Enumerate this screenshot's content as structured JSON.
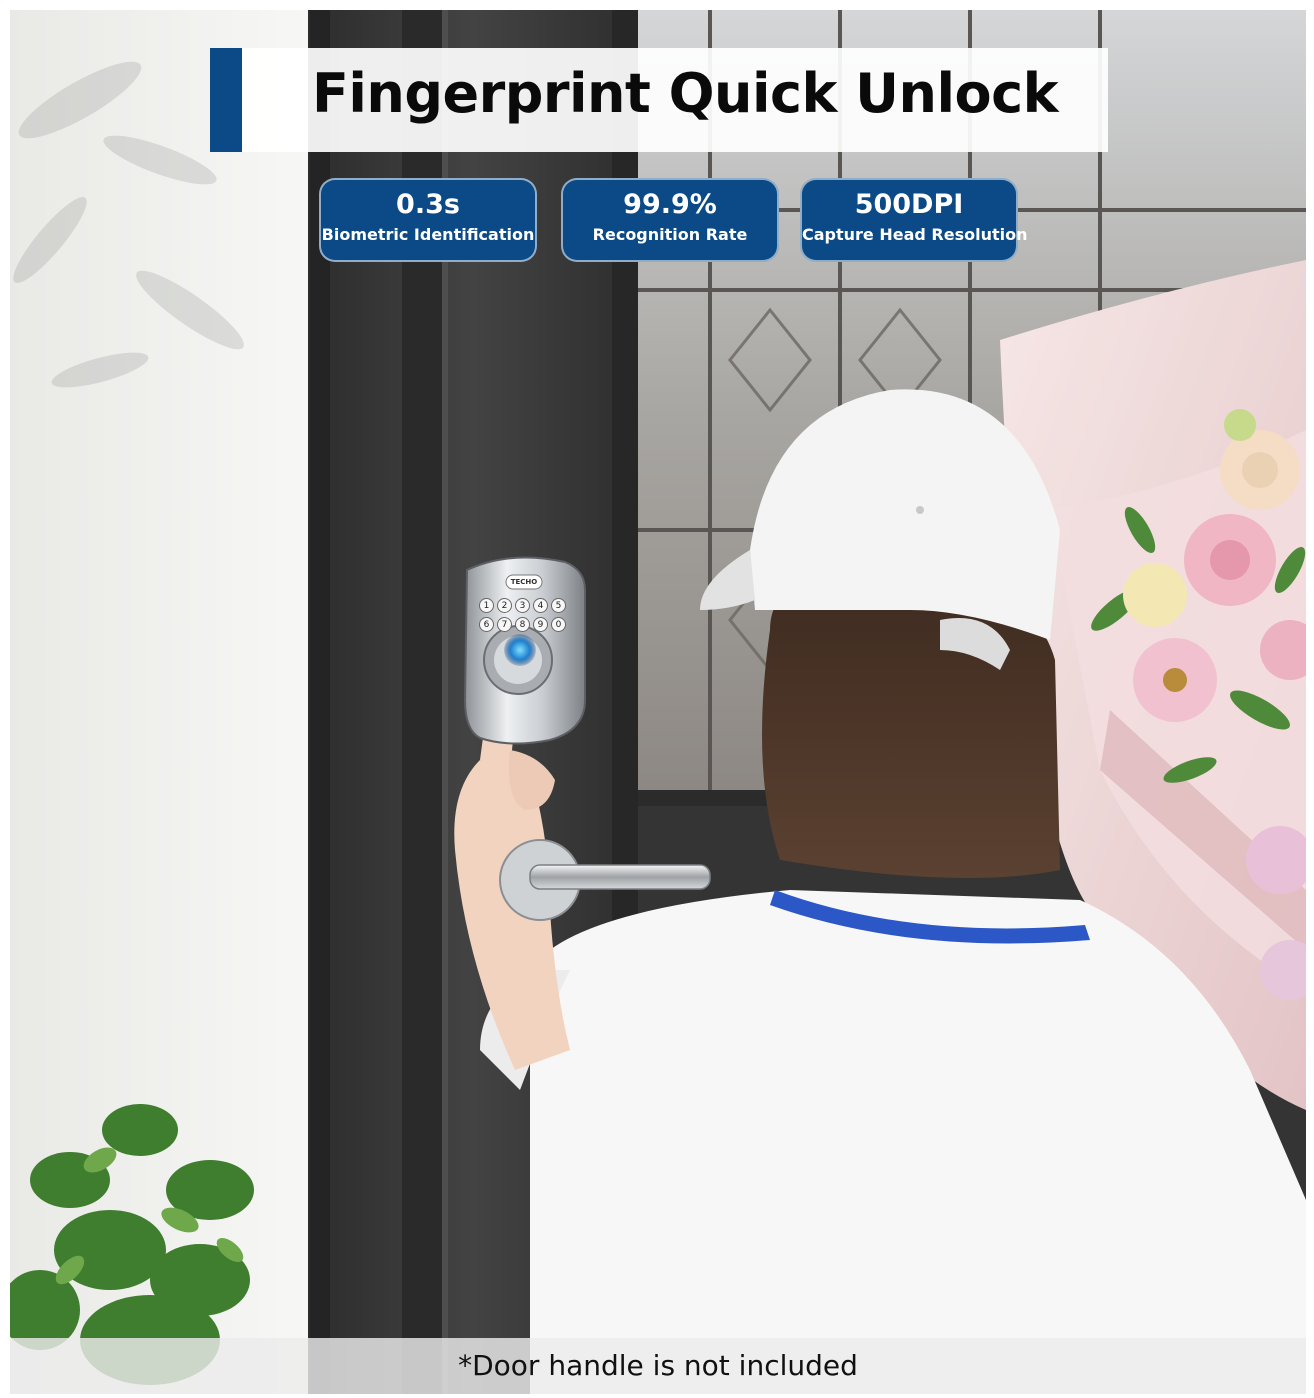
{
  "title": "Fingerprint Quick Unlock",
  "badges": [
    {
      "value": "0.3s",
      "label": "Biometric Identification"
    },
    {
      "value": "99.9%",
      "label": "Recognition Rate"
    },
    {
      "value": "500DPI",
      "label": "Capture Head Resolution"
    }
  ],
  "lock": {
    "brand": "TECHO",
    "keys_row1": [
      "1",
      "2",
      "3",
      "4",
      "5"
    ],
    "keys_row2": [
      "6",
      "7",
      "8",
      "9",
      "0"
    ]
  },
  "footer_note": "*Door handle is not included",
  "colors": {
    "accent_blue": "#0b4a86",
    "door": "#3a3a3a",
    "wall": "#f1f1ef"
  }
}
